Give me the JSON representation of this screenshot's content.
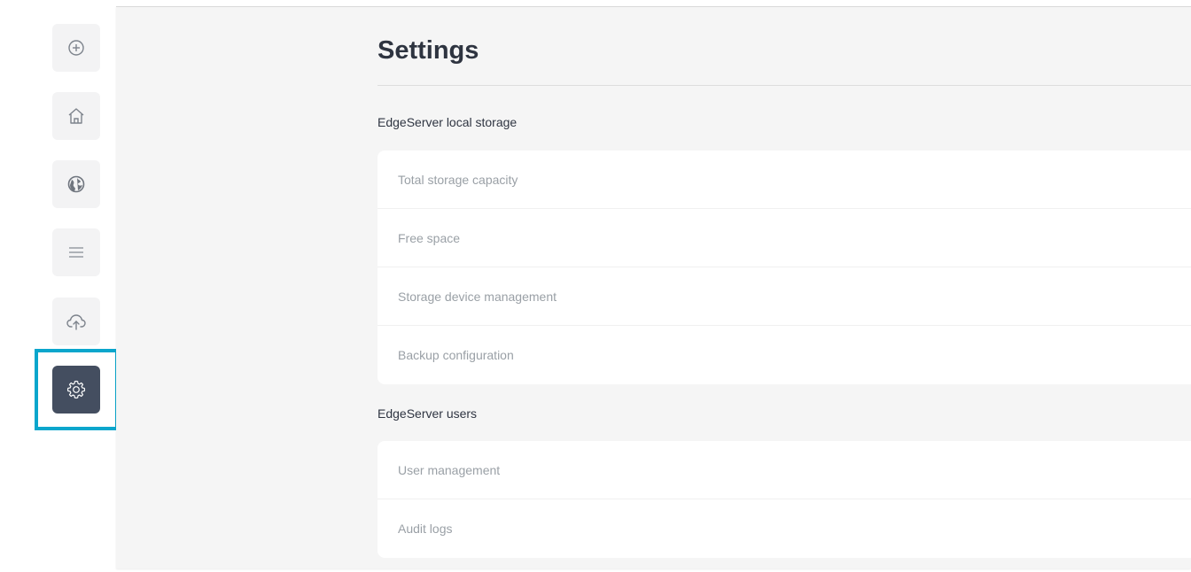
{
  "sidebar": {
    "items": [
      {
        "name": "add",
        "icon": "plus-circle-icon"
      },
      {
        "name": "home",
        "icon": "home-icon"
      },
      {
        "name": "globe",
        "icon": "globe-icon"
      },
      {
        "name": "menu",
        "icon": "menu-icon"
      },
      {
        "name": "upload",
        "icon": "cloud-upload-icon"
      },
      {
        "name": "settings",
        "icon": "gear-icon",
        "active": true
      }
    ]
  },
  "highlight_color": "#0aa6cc",
  "page": {
    "title": "Settings"
  },
  "sections": [
    {
      "label": "EdgeServer local storage",
      "rows": [
        "Total storage capacity",
        "Free space",
        "Storage device management",
        "Backup configuration"
      ]
    },
    {
      "label": "EdgeServer users",
      "rows": [
        "User management",
        "Audit logs"
      ]
    }
  ]
}
